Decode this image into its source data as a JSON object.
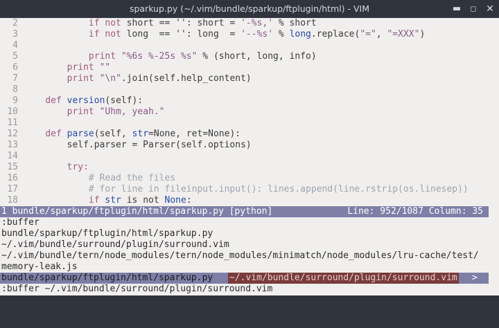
{
  "window": {
    "title": "sparkup.py (~/.vim/bundle/sparkup/ftplugin/html) - VIM",
    "minimize_glyph": "▬",
    "maximize_glyph": "◻",
    "close_glyph": "✕"
  },
  "editor": {
    "lines": [
      {
        "n": "2",
        "tokens": [
          [
            "            ",
            ""
          ],
          [
            "if not ",
            "kw"
          ],
          [
            "short == ",
            ""
          ],
          [
            "''",
            ""
          ],
          [
            ": short = ",
            ""
          ],
          [
            "'-%s,'",
            "str"
          ],
          [
            " % short",
            ""
          ]
        ]
      },
      {
        "n": "3",
        "tokens": [
          [
            "            ",
            ""
          ],
          [
            "if not ",
            "kw"
          ],
          [
            "long  == ",
            ""
          ],
          [
            "''",
            ""
          ],
          [
            ": long  = ",
            ""
          ],
          [
            "'--%s'",
            "str"
          ],
          [
            " % ",
            ""
          ],
          [
            "long",
            "fn"
          ],
          [
            ".replace(",
            ""
          ],
          [
            "\"=\"",
            "str"
          ],
          [
            ", ",
            ""
          ],
          [
            "\"=XXX\"",
            "str"
          ],
          [
            ")",
            ""
          ]
        ]
      },
      {
        "n": "4",
        "tokens": []
      },
      {
        "n": "5",
        "tokens": [
          [
            "            ",
            ""
          ],
          [
            "print ",
            "kw"
          ],
          [
            "\"%6s %-25s %s\"",
            "str"
          ],
          [
            " % (short, long, info)",
            ""
          ]
        ]
      },
      {
        "n": "6",
        "tokens": [
          [
            "        ",
            ""
          ],
          [
            "print ",
            "kw"
          ],
          [
            "\"\"",
            "str"
          ]
        ]
      },
      {
        "n": "7",
        "tokens": [
          [
            "        ",
            ""
          ],
          [
            "print ",
            "kw"
          ],
          [
            "\"\\n\"",
            "str"
          ],
          [
            ".join(self.help_content)",
            ""
          ]
        ]
      },
      {
        "n": "8",
        "tokens": []
      },
      {
        "n": "9",
        "tokens": [
          [
            "    ",
            ""
          ],
          [
            "def ",
            "kw"
          ],
          [
            "version",
            "fn"
          ],
          [
            "(self):",
            ""
          ]
        ]
      },
      {
        "n": "10",
        "tokens": [
          [
            "        ",
            ""
          ],
          [
            "print ",
            "kw"
          ],
          [
            "\"Uhm, yeah.\"",
            "str"
          ]
        ]
      },
      {
        "n": "11",
        "tokens": []
      },
      {
        "n": "12",
        "tokens": [
          [
            "    ",
            ""
          ],
          [
            "def ",
            "kw"
          ],
          [
            "parse",
            "fn"
          ],
          [
            "(self, ",
            ""
          ],
          [
            "str",
            "fn"
          ],
          [
            "=None, ret=None):",
            ""
          ]
        ]
      },
      {
        "n": "13",
        "tokens": [
          [
            "        self.parser = Parser(self.options)",
            ""
          ]
        ]
      },
      {
        "n": "14",
        "tokens": []
      },
      {
        "n": "15",
        "tokens": [
          [
            "        ",
            ""
          ],
          [
            "try:",
            "kw"
          ]
        ]
      },
      {
        "n": "16",
        "tokens": [
          [
            "            ",
            ""
          ],
          [
            "# Read the files",
            "cm"
          ]
        ]
      },
      {
        "n": "17",
        "tokens": [
          [
            "            ",
            ""
          ],
          [
            "# for line in fileinput.input(): lines.append(line.rstrip(os.linesep))",
            "cm"
          ]
        ]
      },
      {
        "n": "18",
        "tokens": [
          [
            "            ",
            ""
          ],
          [
            "if ",
            "kw"
          ],
          [
            "str",
            "fn"
          ],
          [
            " is not ",
            ""
          ],
          [
            "None",
            "fn"
          ],
          [
            ":",
            ""
          ]
        ]
      }
    ]
  },
  "statusline": {
    "left": "1 bundle/sparkup/ftplugin/html/sparkup.py [python]",
    "right": "Line: 952/1087 Column: 35"
  },
  "cmd_output": [
    ":buffer",
    "bundle/sparkup/ftplugin/html/sparkup.py",
    "~/.vim/bundle/surround/plugin/surround.vim",
    "~/.vim/bundle/tern/node_modules/tern/node_modules/minimatch/node_modules/lru-cache/test/",
    "memory-leak.js"
  ],
  "wildmenu": {
    "items": [
      "bundle/sparkup/ftplugin/html/sparkup.py",
      "~/.vim/bundle/surround/plugin/surround.vim"
    ],
    "selected_index": 1,
    "more": ">"
  },
  "command_line": ":buffer ~/.vim/bundle/surround/plugin/surround.vim",
  "colors": {
    "keyword": "#a05a80",
    "function": "#2a4aa0",
    "string": "#8a5a8a",
    "comment": "#9da4ad",
    "statusline_bg": "#7d7fa7",
    "wildmenu_selected_bg": "#7a3b3b"
  }
}
